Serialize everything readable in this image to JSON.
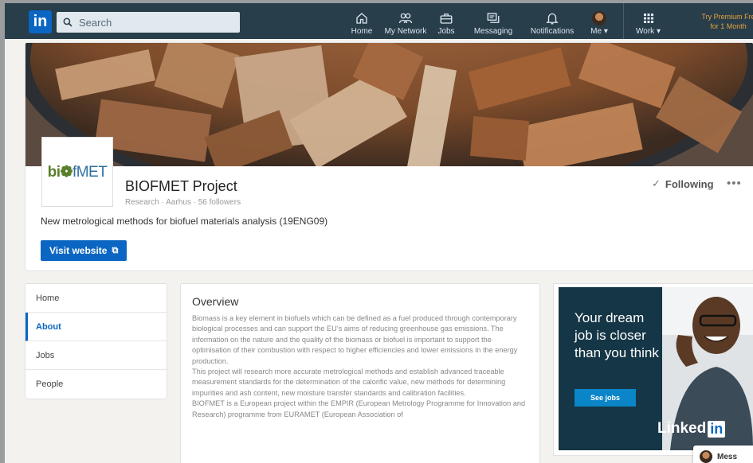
{
  "nav": {
    "logo": "in",
    "search_placeholder": "Search",
    "items": {
      "home": "Home",
      "network": "My Network",
      "jobs": "Jobs",
      "messaging": "Messaging",
      "notifications": "Notifications",
      "me": "Me",
      "work": "Work"
    },
    "premium_line1": "Try Premium Fre",
    "premium_line2": "for 1 Month"
  },
  "company": {
    "logo_text_1": "bi",
    "logo_text_2": "fMET",
    "name": "BIOFMET Project",
    "meta": "Research · Aarhus · 56 followers",
    "tagline": "New metrological methods for biofuel materials analysis (19ENG09)",
    "visit_label": "Visit website",
    "following_label": "Following",
    "more_label": "•••"
  },
  "leftnav": {
    "items": [
      "Home",
      "About",
      "Jobs",
      "People"
    ],
    "active": "About"
  },
  "overview": {
    "title": "Overview",
    "paragraphs": [
      "Biomass is a key element in biofuels which can be defined as a fuel produced through contemporary biological processes and can support the EU's aims of reducing greenhouse gas emissions. The information on the nature and the quality of the biomass or biofuel is important to support the optimisation of their combustion with respect to higher efficiencies and lower emissions in the energy production.",
      "This project will research more accurate metrological methods and establish advanced traceable measurement standards for the determination of the calorific value, new methods for determining impurities and ash content, new moisture transfer standards and calibration facilities.",
      "BIOFMET is a European project within the EMPIR (European Metrology Programme for Innovation and Research) programme from EURAMET (European Association of"
    ]
  },
  "ad": {
    "headline": "Your dream job is closer than you think",
    "button": "See jobs",
    "brand": "Linked",
    "brand_in": "in"
  },
  "messaging": {
    "label": "Mess"
  },
  "colors": {
    "nav_bg": "#283e4a",
    "brand_blue": "#0a66c2",
    "premium_gold": "#e7a33e",
    "ad_bg": "#153646"
  }
}
